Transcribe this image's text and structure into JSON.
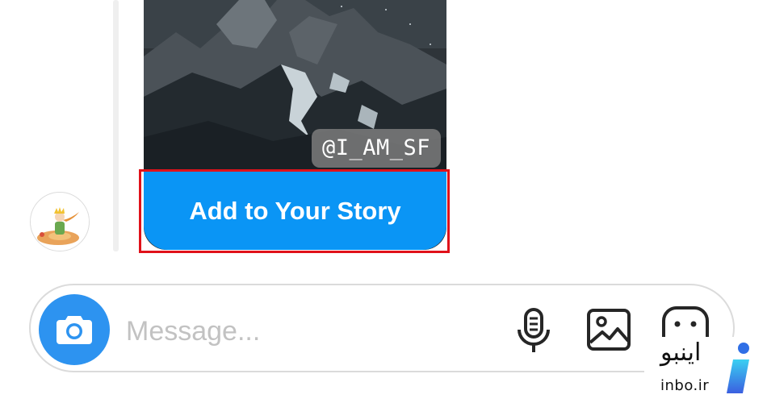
{
  "story": {
    "username": "@I_AM_SF",
    "add_button_label": "Add to Your Story"
  },
  "composer": {
    "placeholder": "Message..."
  },
  "watermark": {
    "text_fa": "اینبو",
    "text_en": "inbo.ir"
  },
  "colors": {
    "accent": "#0a95f5",
    "camera": "#2d93f0",
    "highlight": "#e0111a"
  },
  "icons": {
    "camera": "camera-icon",
    "mic": "microphone-icon",
    "gallery": "gallery-icon",
    "sticker": "sticker-icon"
  }
}
